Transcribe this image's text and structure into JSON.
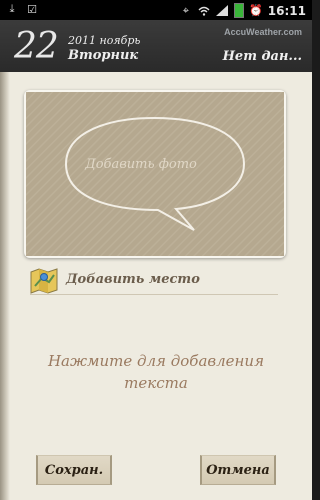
{
  "status_bar": {
    "time": "16:11",
    "left_icons": [
      "download-icon",
      "task-icon"
    ],
    "right_icons": [
      "gps-icon",
      "wifi-icon",
      "signal-icon",
      "battery-icon",
      "alarm-icon"
    ]
  },
  "header": {
    "day": "22",
    "month_year": "2011 ноябрь",
    "weekday": "Вторник",
    "weather_source": "AccuWeather.com",
    "weather_status": "Нет дан..."
  },
  "photo": {
    "label": "Добавить фото"
  },
  "place": {
    "label": "Добавить место",
    "icon": "map-icon"
  },
  "text_area": {
    "placeholder": "Нажмите для добавления текста"
  },
  "buttons": {
    "save": "Сохран.",
    "cancel": "Отмена"
  },
  "colors": {
    "header_bg": "#2f2f2f",
    "page_bg": "#eeebe0",
    "photo_bg": "#b5a88f",
    "hint_text": "#9a7a60",
    "battery": "#3ab53a"
  }
}
